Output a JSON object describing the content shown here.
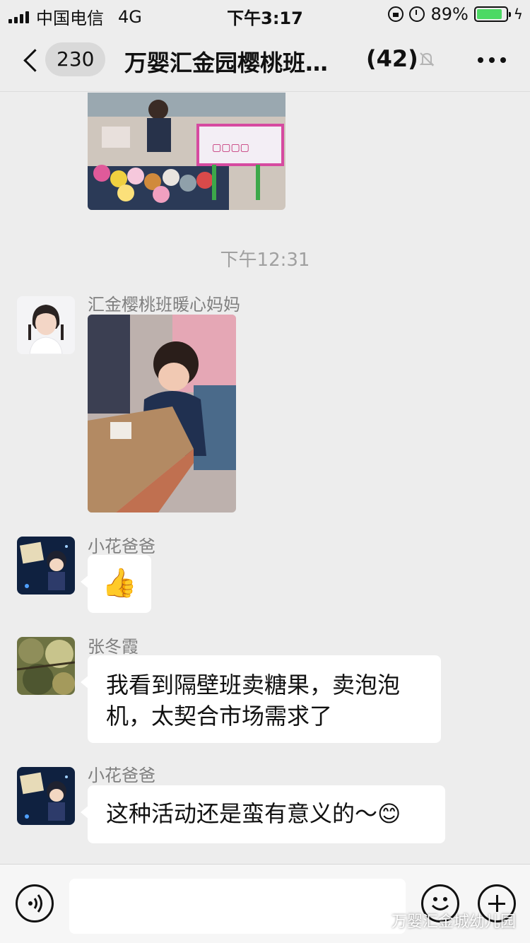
{
  "status_bar": {
    "carrier": "中国电信",
    "network": "4G",
    "time": "下午3:17",
    "battery": "89%",
    "battery_level": 0.89
  },
  "header": {
    "unread_count": "230",
    "title": "万婴汇金园樱桃班…",
    "member_count": "(42)"
  },
  "chat": {
    "timestamp": "下午12:31",
    "messages": [
      {
        "sender": "汇金樱桃班暖心妈妈",
        "type": "image"
      },
      {
        "sender": "小花爸爸",
        "type": "emoji",
        "emoji": "👍"
      },
      {
        "sender": "张冬霞",
        "type": "text",
        "lines": [
          "我看到隔壁班卖糖果，卖泡泡",
          "机，太契合市场需求了"
        ]
      },
      {
        "sender": "小花爸爸",
        "type": "text",
        "text": "这种活动还是蛮有意义的～",
        "emoji": "😊"
      }
    ]
  },
  "input_bar": {
    "placeholder": ""
  },
  "watermark": {
    "text": "万婴汇金城幼儿园"
  },
  "colors": {
    "background": "#ededed",
    "bubble": "#ffffff",
    "battery": "#4cd964"
  }
}
